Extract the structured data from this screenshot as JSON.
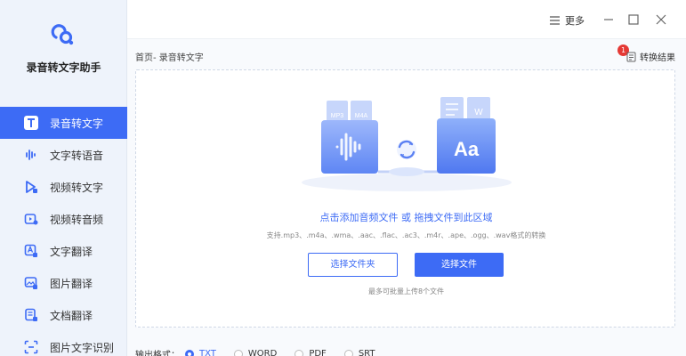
{
  "app": {
    "title": "录音转文字助手"
  },
  "nav": {
    "items": [
      {
        "label": "录音转文字",
        "icon": "t-icon",
        "active": true
      },
      {
        "label": "文字转语音",
        "icon": "soundwave-icon"
      },
      {
        "label": "视频转文字",
        "icon": "video-text-icon"
      },
      {
        "label": "视频转音频",
        "icon": "video-audio-icon"
      },
      {
        "label": "文字翻译",
        "icon": "translate-icon"
      },
      {
        "label": "图片翻译",
        "icon": "image-translate-icon"
      },
      {
        "label": "文档翻译",
        "icon": "doc-translate-icon"
      },
      {
        "label": "图片文字识别",
        "icon": "ocr-icon"
      }
    ]
  },
  "titlebar": {
    "more_label": "更多"
  },
  "breadcrumb": "首页- 录音转文字",
  "result": {
    "label": "转换结果",
    "badge": "1"
  },
  "drop": {
    "main_text": "点击添加音频文件 或 拖拽文件到此区域",
    "sub_text": "支持.mp3、.m4a、.wma、.aac、.flac、.ac3、.m4r、.ape、.ogg、.wav格式的转换",
    "folder_button": "选择文件夹",
    "file_button": "选择文件",
    "limit_text": "最多可批量上传8个文件",
    "illustration": {
      "tags_left": [
        "MP3",
        "M4A"
      ],
      "card_right": "Aa"
    }
  },
  "formats": {
    "label": "输出格式：",
    "options": [
      "TXT",
      "WORD",
      "PDF",
      "SRT"
    ],
    "selected": "TXT"
  },
  "colors": {
    "accent": "#3d6bf5",
    "sidebar_bg": "#eef3fb",
    "badge": "#e53935"
  }
}
